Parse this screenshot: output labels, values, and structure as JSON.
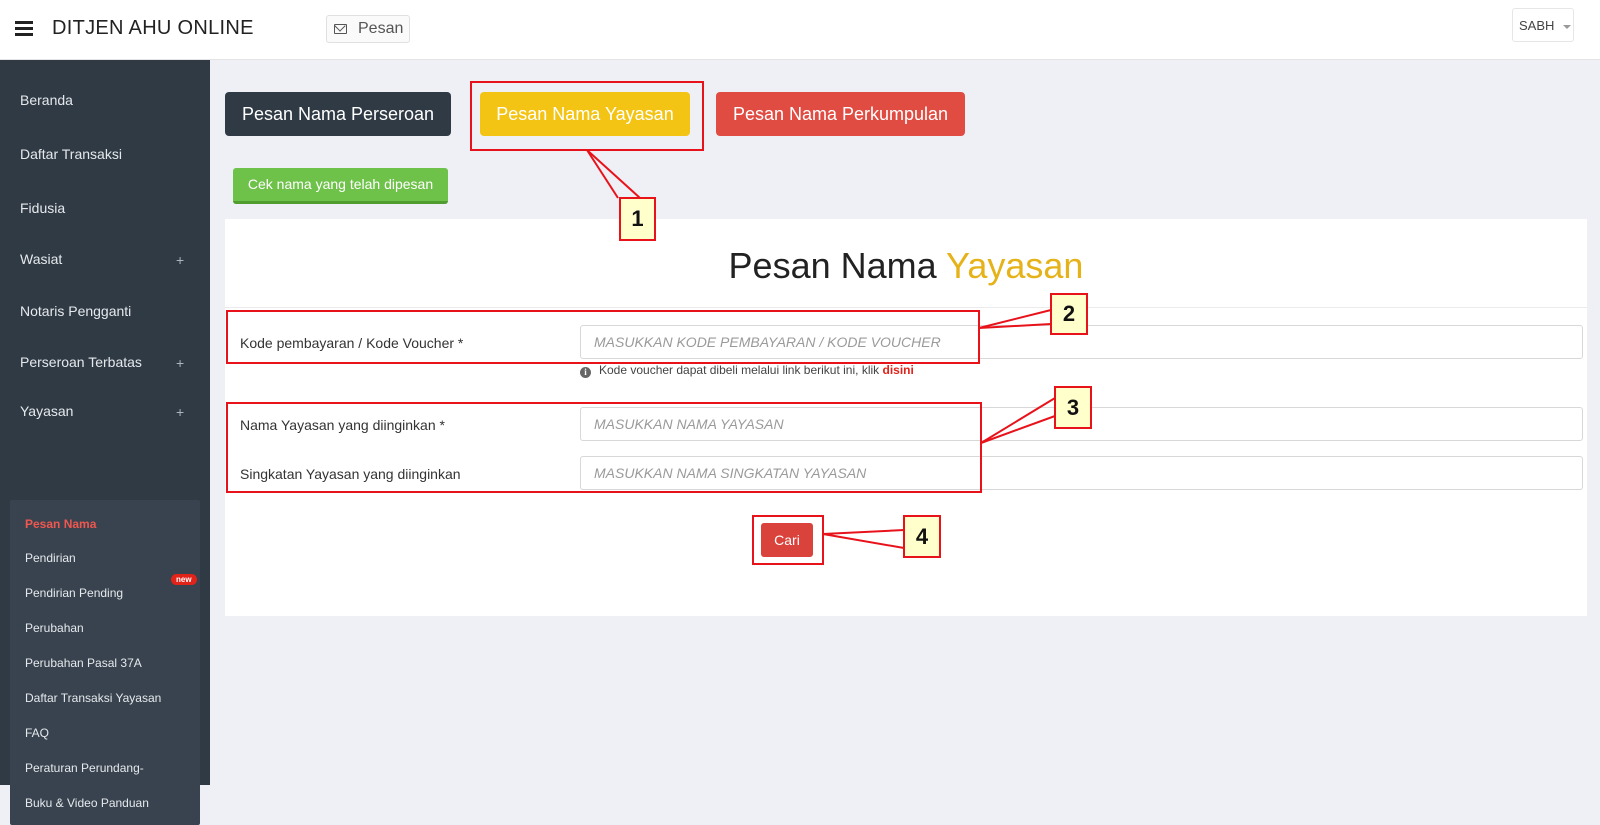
{
  "header": {
    "title": "DITJEN AHU ONLINE",
    "pesan_label": "Pesan",
    "user_label": "SABH"
  },
  "sidebar": {
    "items": [
      {
        "label": "Beranda",
        "expandable": false
      },
      {
        "label": "Daftar Transaksi",
        "expandable": false
      },
      {
        "label": "Fidusia",
        "expandable": false
      },
      {
        "label": "Wasiat",
        "expandable": true
      },
      {
        "label": "Notaris Pengganti",
        "expandable": false
      },
      {
        "label": "Perseroan Terbatas",
        "expandable": true
      },
      {
        "label": "Yayasan",
        "expandable": true
      }
    ],
    "expand_symbol": "+",
    "submenu": [
      {
        "label": "Pesan Nama",
        "active": true
      },
      {
        "label": "Pendirian"
      },
      {
        "label": "Pendirian Pending",
        "badge": "new"
      },
      {
        "label": "Perubahan"
      },
      {
        "label": "Perubahan Pasal 37A"
      },
      {
        "label": "Daftar Transaksi Yayasan"
      },
      {
        "label": "FAQ"
      },
      {
        "label": "Peraturan Perundang-"
      },
      {
        "label": "Buku & Video Panduan"
      }
    ]
  },
  "tabs": {
    "perseroan": "Pesan Nama Perseroan",
    "yayasan": "Pesan Nama Yayasan",
    "perkumpulan": "Pesan Nama Perkumpulan"
  },
  "cek_button": "Cek nama yang telah dipesan",
  "panel": {
    "title_main": "Pesan Nama ",
    "title_highlight": "Yayasan",
    "fields": [
      {
        "label": "Kode pembayaran / Kode Voucher *",
        "placeholder": "MASUKKAN KODE PEMBAYARAN / KODE VOUCHER",
        "value": ""
      },
      {
        "label": "Nama Yayasan yang diinginkan *",
        "placeholder": "MASUKKAN NAMA YAYASAN",
        "value": ""
      },
      {
        "label": "Singkatan Yayasan yang diinginkan",
        "placeholder": "MASUKKAN NAMA SINGKATAN YAYASAN",
        "value": ""
      }
    ],
    "help_text": "Kode voucher dapat dibeli melalui link berikut ini, klik ",
    "help_link": "disini",
    "cari_button": "Cari"
  },
  "annotations": [
    "1",
    "2",
    "3",
    "4"
  ],
  "colors": {
    "sidebar_bg": "#2f3a45",
    "accent_yellow": "#f4c414",
    "accent_red": "#e04b42",
    "accent_green": "#6ec24a",
    "annotation_red": "#e8121b",
    "callout_bg": "#ffffcc"
  }
}
